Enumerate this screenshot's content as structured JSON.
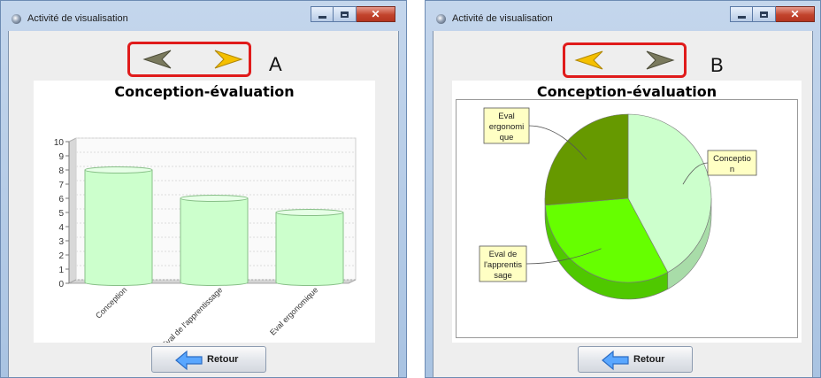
{
  "window_title": "Activité de visualisation",
  "panel_a": {
    "letter": "A",
    "chart_data": {
      "type": "bar",
      "title": "Conception-évaluation",
      "categories": [
        "Conception",
        "Eval de l'apprentissage",
        "Eval ergonomique"
      ],
      "values": [
        8,
        6,
        5
      ],
      "ylim": [
        0,
        10
      ],
      "yticks": [
        "0",
        "1",
        "2",
        "3",
        "4",
        "5",
        "6",
        "7",
        "8",
        "9",
        "10"
      ],
      "grid": true,
      "bar_color": "#ccffcc",
      "style": "3d-cylinder"
    }
  },
  "panel_b": {
    "letter": "B",
    "chart_data": {
      "type": "pie",
      "title": "Conception-évaluation",
      "categories": [
        "Conception",
        "Eval de l'apprentissage",
        "Eval ergonomique"
      ],
      "values": [
        8,
        6,
        5
      ],
      "label_lines": [
        [
          "Conceptio",
          "n"
        ],
        [
          "Eval de",
          "l'apprentis",
          "sage"
        ],
        [
          "Eval",
          "ergonomi",
          "que"
        ]
      ],
      "colors": [
        "#ccffcc",
        "#66ff00",
        "#669900"
      ],
      "style": "3d"
    }
  },
  "nav": {
    "prev_icon": "left-arrow-icon",
    "next_icon": "right-arrow-icon"
  },
  "retour_label": "Retour",
  "colors": {
    "highlight_box": "#e01b1b",
    "arrow_active": "#f5c000",
    "arrow_inactive": "#7a7a5e"
  }
}
